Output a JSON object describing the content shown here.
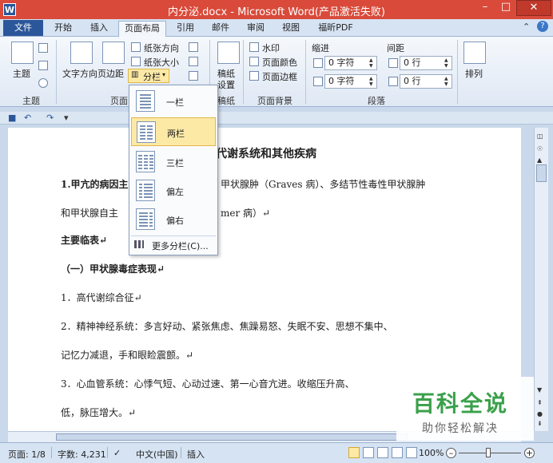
{
  "window": {
    "app_icon": "W",
    "title": "内分泌.docx - Microsoft Word(产品激活失败)",
    "min": "–",
    "max": "□",
    "close": "✕"
  },
  "tabs": {
    "file": "文件",
    "items": [
      "开始",
      "插入",
      "页面布局",
      "引用",
      "邮件",
      "审阅",
      "视图",
      "福昕PDF"
    ],
    "active": "页面布局",
    "help_caret": "⌃",
    "help": "?"
  },
  "ribbon": {
    "theme": {
      "button": "主题",
      "group": "主题"
    },
    "page_setup": {
      "text_direction": "文字方向",
      "margins": "页边距",
      "orientation": "纸张方向",
      "size": "纸张大小",
      "columns": "分栏",
      "group": "页面"
    },
    "draft": {
      "button_line1": "稿纸",
      "button_line2": "设置",
      "group": "稿纸"
    },
    "page_background": {
      "watermark": "水印",
      "page_color": "页面颜色",
      "page_borders": "页面边框",
      "group": "页面背景"
    },
    "paragraph": {
      "indent_title": "缩进",
      "spacing_title": "间距",
      "indent_left": "0 字符",
      "indent_right": "0 字符",
      "spacing_before": "0 行",
      "spacing_after": "0 行",
      "group": "段落"
    },
    "arrange": {
      "button": "排列"
    }
  },
  "columns_menu": {
    "items": [
      "一栏",
      "两栏",
      "三栏",
      "偏左",
      "偏右"
    ],
    "highlighted": "两栏",
    "more": "更多分栏(C)..."
  },
  "document": {
    "title_fragment": "代谢系统和其他疾病",
    "lines": [
      {
        "text": "1.甲亢的病因主",
        "bold": true
      },
      {
        "text": "甲状腺肿（Graves 病）、多结节性毒性甲状腺肿",
        "bold": false
      },
      {
        "text": "和甲状腺自主",
        "bold": false
      },
      {
        "text": "mer 病）↵",
        "bold": false
      },
      {
        "text": "主要临表↵",
        "bold": true
      },
      {
        "text": "（一）甲状腺毒症表现↵",
        "bold": true
      },
      {
        "text": "1．高代谢综合征↵",
        "bold": false
      },
      {
        "text": "2．精神神经系统：多言好动、紧张焦虑、焦躁易怒、失眠不安、思想不集中、",
        "bold": false
      },
      {
        "text": "记忆力减退，手和眼睑震颤。↵",
        "bold": false
      },
      {
        "text": "3．心血管系统：心悸气短、心动过速、第一心音亢进。收缩压升高、",
        "bold": false
      },
      {
        "text": "低，脉压增大。↵",
        "bold": false
      }
    ]
  },
  "status": {
    "page": "页面: 1/8",
    "words": "字数: 4,231",
    "language": "中文(中国)",
    "insert": "插入",
    "zoom": "100%",
    "zoom_minus": "–",
    "zoom_plus": "+"
  },
  "watermark_brand": {
    "main": "百科全说",
    "sub": "助你轻松解决"
  }
}
